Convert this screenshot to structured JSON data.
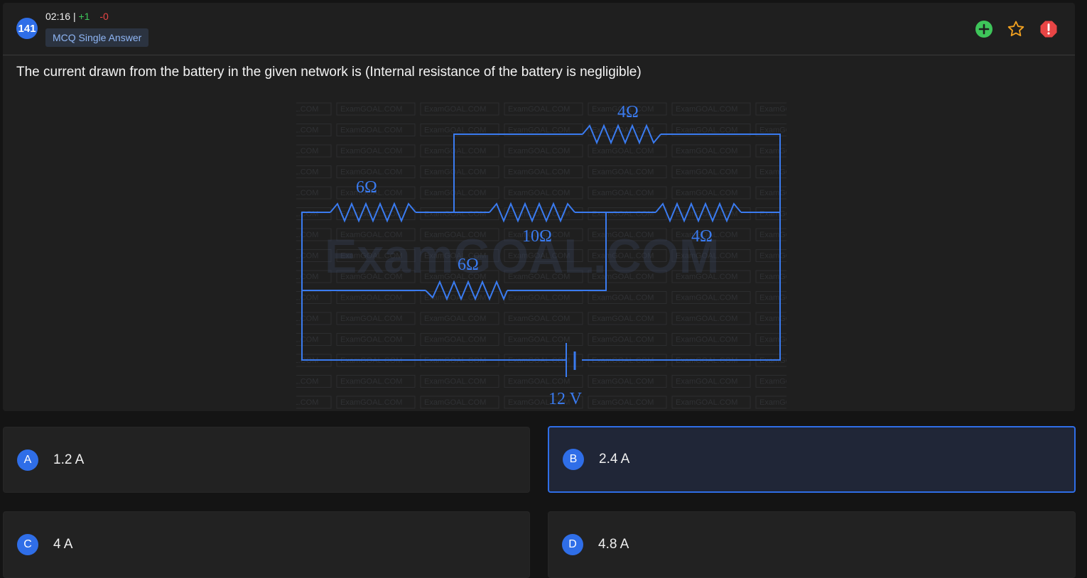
{
  "question": {
    "number": "141",
    "timer": "02:16",
    "separator": "|",
    "marks_positive": "+1",
    "marks_negative": "-0",
    "type": "MCQ Single Answer",
    "text": "The current drawn from the battery in the given network is (Internal resistance of the battery is negligible)"
  },
  "actions": {
    "add_icon": "plus-circle-icon",
    "bookmark_icon": "star-outline-icon",
    "report_icon": "alert-octagon-icon",
    "colors": {
      "add": "#3ec55a",
      "bookmark": "#f0a020",
      "report": "#e84545"
    }
  },
  "figure": {
    "watermark": "ExamGOAL.COM",
    "labels": {
      "r_top": "4Ω",
      "r_left": "6Ω",
      "r_middle": "10Ω",
      "r_right": "4Ω",
      "r_lower": "6Ω",
      "battery": "12 V"
    }
  },
  "options": [
    {
      "letter": "A",
      "text": "1.2 A",
      "selected": false
    },
    {
      "letter": "B",
      "text": "2.4 A",
      "selected": true
    },
    {
      "letter": "C",
      "text": "4 A",
      "selected": false
    },
    {
      "letter": "D",
      "text": "4.8 A",
      "selected": false
    }
  ],
  "theme": {
    "accent": "#2f6ee8",
    "circuit": "#3a7bf0"
  }
}
